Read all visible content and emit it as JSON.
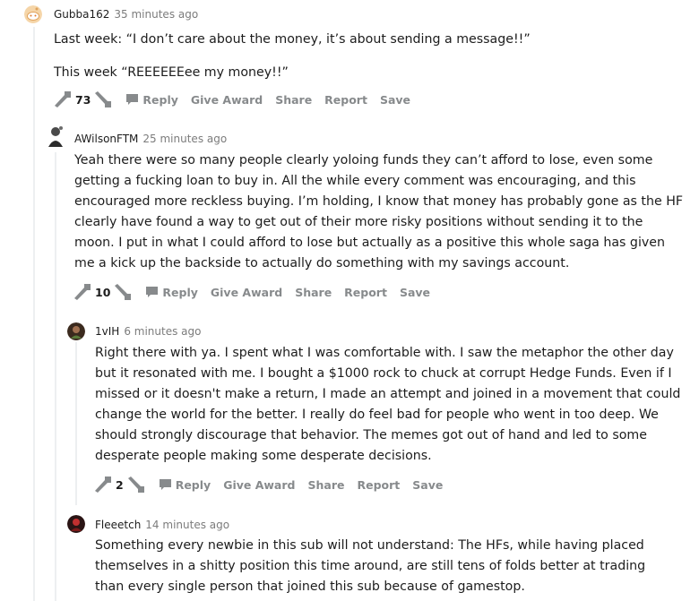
{
  "actions": {
    "reply": "Reply",
    "give_award": "Give Award",
    "share": "Share",
    "report": "Report",
    "save": "Save"
  },
  "comments": [
    {
      "username": "Gubba162",
      "time": "35 minutes ago",
      "paragraphs": [
        "Last week: “I don’t care about the money, it’s about sending a message!!”",
        "This week “REEEEEEee my money!!”"
      ],
      "score": "73"
    },
    {
      "username": "AWilsonFTM",
      "time": "25 minutes ago",
      "paragraphs": [
        "Yeah there were so many people clearly yoloing funds they can’t afford to lose, even some getting a fucking loan to buy in. All the while every comment was encouraging, and this encouraged more reckless buying. I’m holding, I know that money has probably gone as the HF clearly have found a way to get out of their more risky positions without sending it to the moon. I put in what I could afford to lose but actually as a positive this whole saga has given me a kick up the backside to actually do something with my savings account."
      ],
      "score": "10"
    },
    {
      "username": "1vIH",
      "time": "6 minutes ago",
      "paragraphs": [
        "Right there with ya. I spent what I was comfortable with. I saw the metaphor the other day but it resonated with me. I bought a $1000 rock to chuck at corrupt Hedge Funds. Even if I missed or it doesn't make a return, I made an attempt and joined in a movement that could change the world for the better. I really do feel bad for people who went in too deep. We should strongly discourage that behavior. The memes got out of hand and led to some desperate people making some desperate decisions."
      ],
      "score": "2"
    },
    {
      "username": "Fleeetch",
      "time": "14 minutes ago",
      "paragraphs": [
        "Something every newbie in this sub will not understand: The HFs, while having placed themselves in a shitty position this time around, are still tens of folds better at trading than every single person that joined this sub because of gamestop."
      ]
    }
  ],
  "colors": {
    "text": "#1c1c1c",
    "meta": "#7c7c7c",
    "action": "#878a8c",
    "thread_line": "#edeff1",
    "arrow": "#878a8c"
  }
}
